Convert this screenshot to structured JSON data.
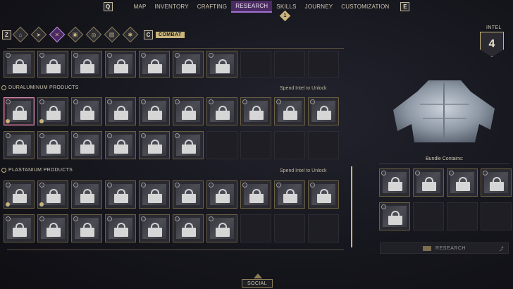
{
  "nav": {
    "left_key": "Q",
    "right_key": "E",
    "tabs": [
      "MAP",
      "INVENTORY",
      "CRAFTING",
      "RESEARCH",
      "SKILLS",
      "JOURNEY",
      "CUSTOMIZATION"
    ],
    "active_tab": "RESEARCH",
    "notification_count": "1"
  },
  "categories": {
    "left_key": "Z",
    "right_key": "C",
    "label": "COMBAT",
    "icons": [
      "home-icon",
      "arrow-icon",
      "swords-icon",
      "armor-icon",
      "compass-icon",
      "chest-icon",
      "gear-icon"
    ]
  },
  "sections": [
    {
      "title": "DURALUMINUM PRODUCTS",
      "action": "Spend Intel to Unlock"
    },
    {
      "title": "PLASTANIUM PRODUCTS",
      "action": "Spend Intel to Unlock"
    }
  ],
  "intel": {
    "label": "INTEL",
    "value": "4"
  },
  "bundle": {
    "label": "Bundle Contains:"
  },
  "research_button": {
    "label": "RESEARCH"
  },
  "social": {
    "label": "SOCIAL"
  },
  "colors": {
    "accent": "#c9b57c",
    "active_tab": "#4b2a63",
    "selected": "#d78fae"
  }
}
